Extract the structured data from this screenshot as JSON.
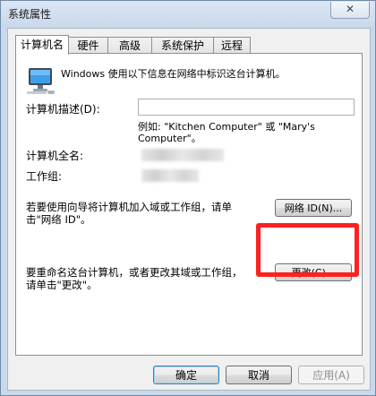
{
  "window": {
    "title": "系统属性",
    "close_label": "✕"
  },
  "tabs": [
    {
      "label": "计算机名",
      "active": true
    },
    {
      "label": "硬件",
      "active": false
    },
    {
      "label": "高级",
      "active": false
    },
    {
      "label": "系统保护",
      "active": false
    },
    {
      "label": "远程",
      "active": false
    }
  ],
  "panel": {
    "intro_text": "Windows 使用以下信息在网络中标识这台计算机。",
    "description_label": "计算机描述(D):",
    "description_value": "",
    "example_line1": "例如: \"Kitchen Computer\" 或 \"Mary's",
    "example_line2": "Computer\"。",
    "full_name_label": "计算机全名:",
    "workgroup_label": "工作组:",
    "network_text_line1": "若要使用向导将计算机加入域或工作组，请单",
    "network_text_line2": "击\"网络 ID\"。",
    "network_id_button": "网络 ID(N)...",
    "rename_text_line1": "要重命名这台计算机，或者更改其域或工作组，",
    "rename_text_line2": "请单击\"更改\"。",
    "change_button": "更改(C)..."
  },
  "footer": {
    "ok_button": "确定",
    "cancel_button": "取消",
    "apply_button": "应用(A)"
  },
  "colors": {
    "highlight": "#ff2020",
    "title_gradient_top": "#dbe6f4",
    "panel_bg": "#ffffff"
  }
}
